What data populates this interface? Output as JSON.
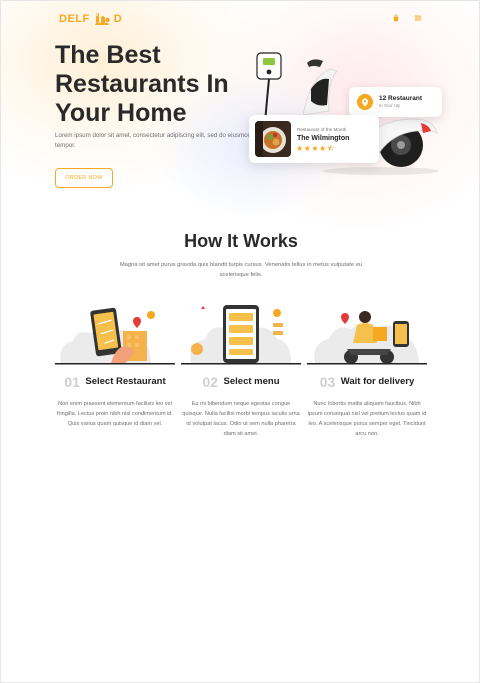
{
  "header": {
    "logo_text": "DELF",
    "logo_text_end": "D",
    "icons": [
      "shopping-bag-icon",
      "menu-icon"
    ]
  },
  "hero": {
    "title": "The Best Restaurants In Your Home",
    "description": "Lorem ipsum dolor sit amet, consectetur adipiscing elit, sed do eiusmod tempor.",
    "cta_label": "ORDER NOW",
    "restaurant_card": {
      "title": "12 Restaurant",
      "subtitle": "In Your city"
    },
    "dish_card": {
      "label": "Restaurant of the Month",
      "name": "The Wilmington",
      "rating": 4.5,
      "stars": "★★★★⯪"
    }
  },
  "how_it_works": {
    "title": "How It Works",
    "description": "Magna sit amet purus gravida quis blandit turpis cursus. Venenatis tellus in metus vulputate eu scelerisque felis.",
    "steps": [
      {
        "number": "01",
        "title": "Select Restaurant",
        "text": "Non enim praesent elementum facilisis leo vel fringilla. Lectus proin nibh nisl condimentum id. Quis varius quam quisque id diam vel."
      },
      {
        "number": "02",
        "title": "Select menu",
        "text": "Eu mi bibendum neque egestas congue quisque. Nulla facilisi morbi tempus iaculis urna id volutpat lacus. Odio ut sem nulla pharetra diam sit amet."
      },
      {
        "number": "03",
        "title": "Wait for delivery",
        "text": "Nunc lobortis mattis aliquam faucibus. Nibh ipsum consequat nisl vel pretium lectus quam id leo. A scelerisque purus semper eget. Tincidunt arcu non."
      }
    ]
  },
  "colors": {
    "accent": "#f6a820",
    "heading": "#2a2a2a",
    "body_text": "#6f6f6f",
    "step_number": "#cfcfcf"
  }
}
